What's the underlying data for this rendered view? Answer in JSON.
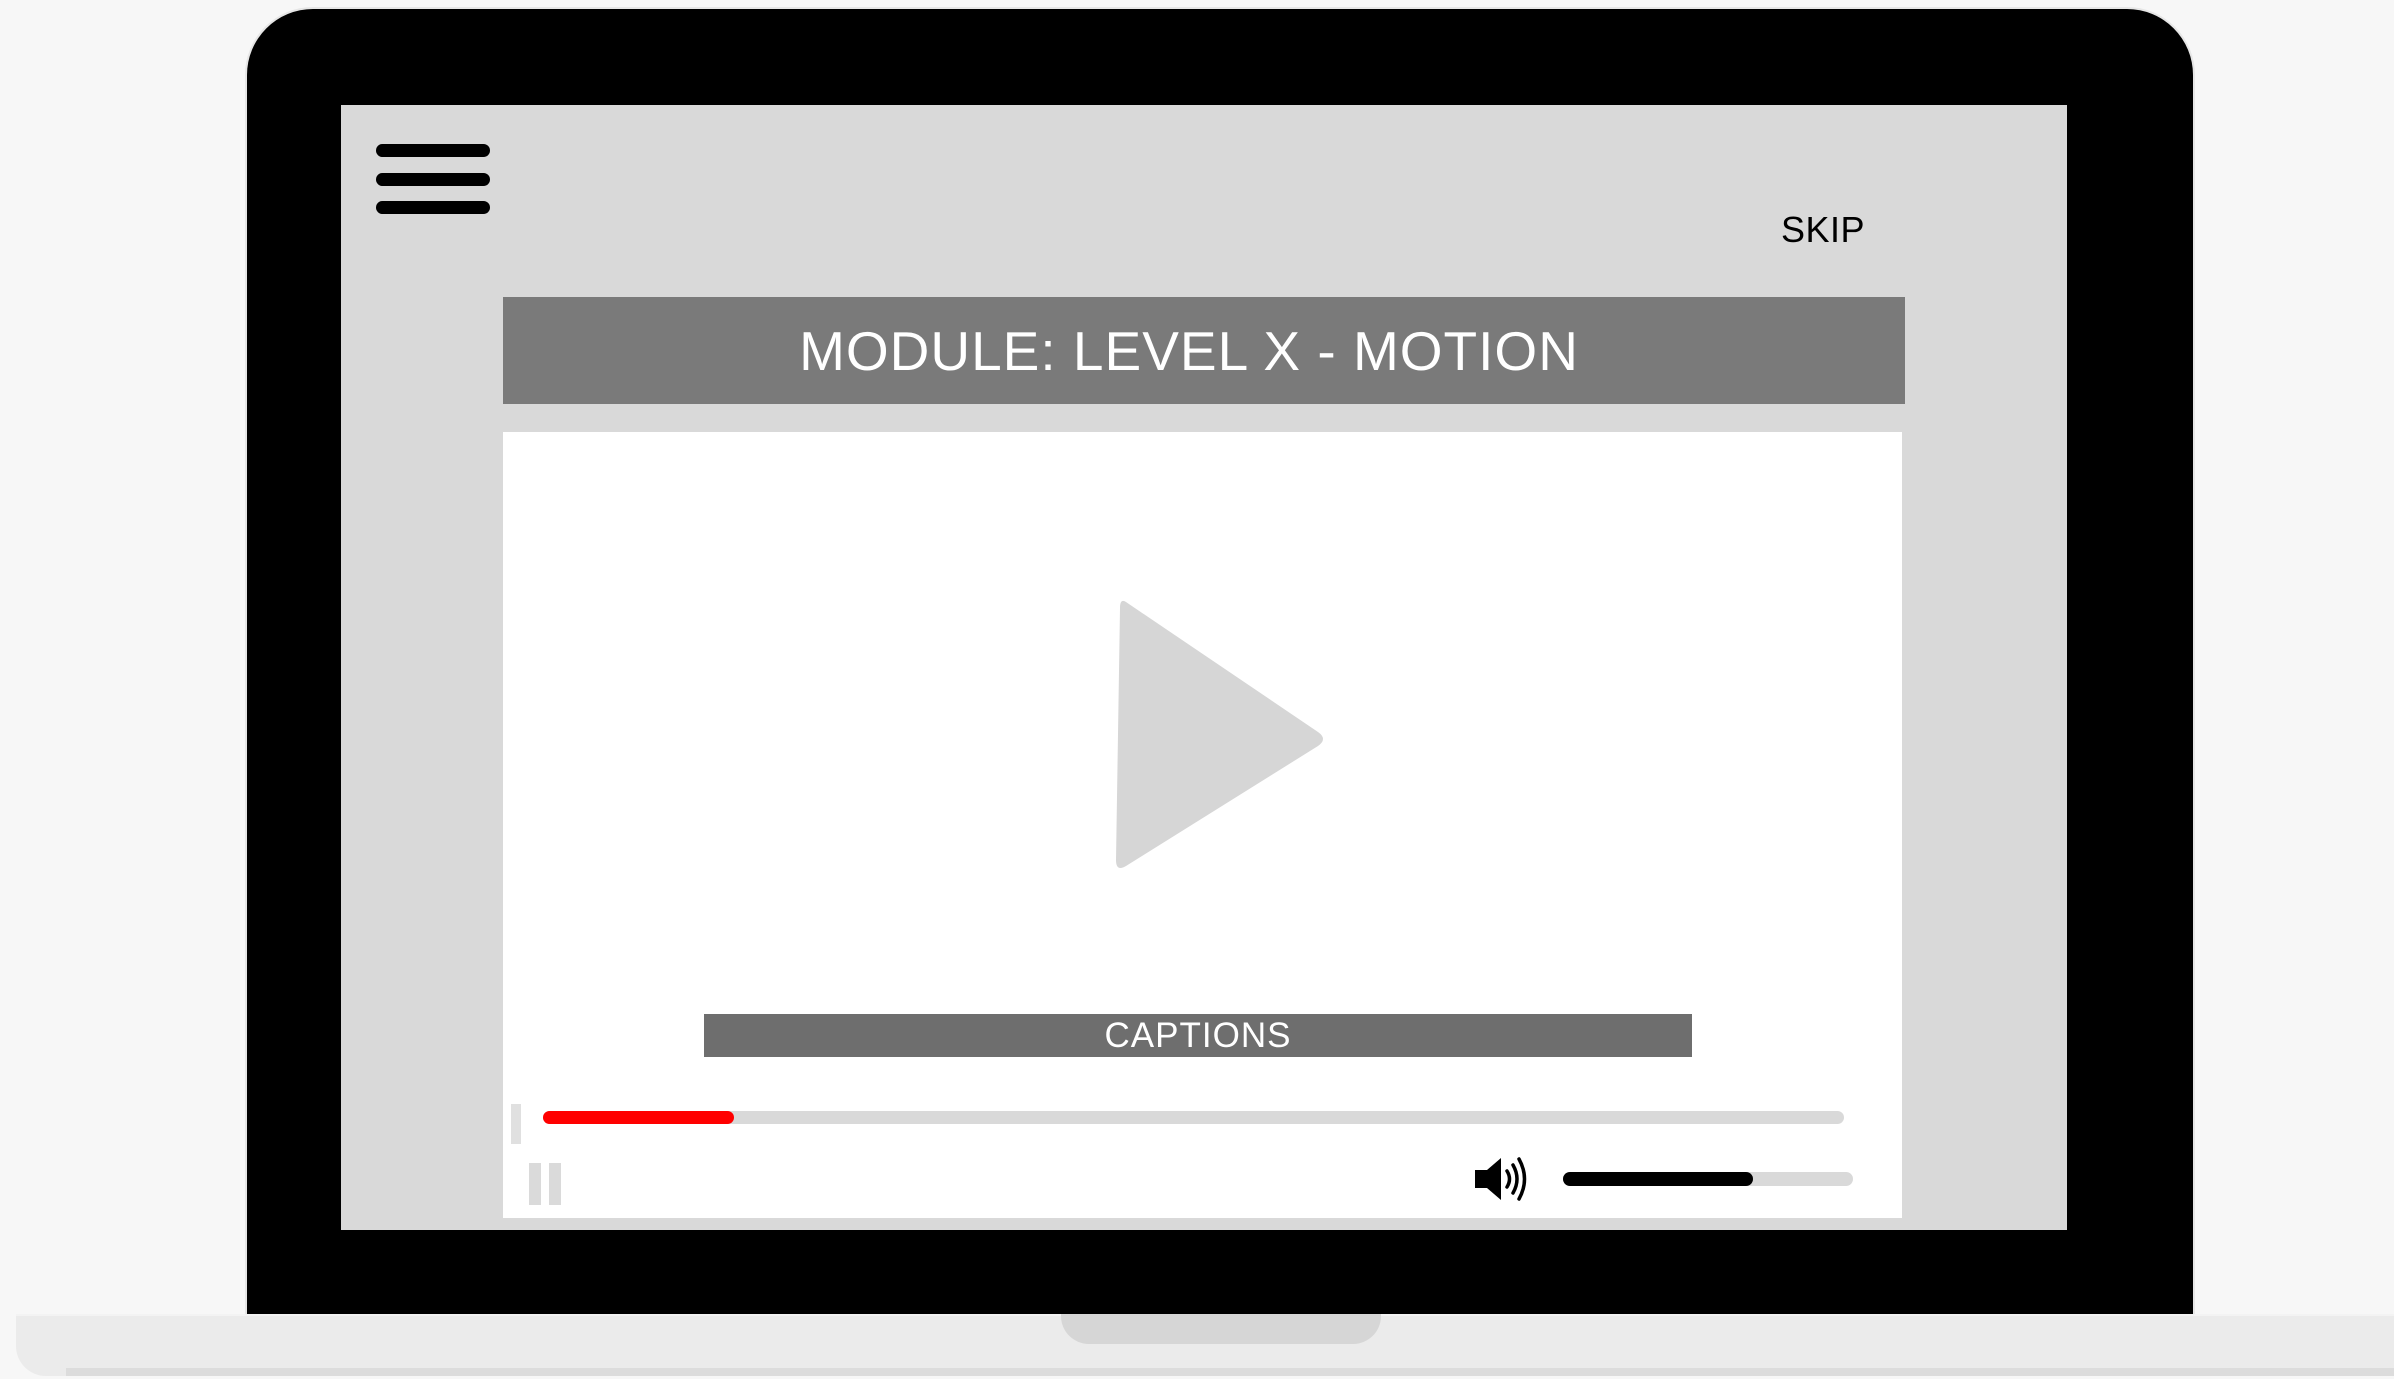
{
  "header": {
    "menu_icon": "hamburger-menu-icon",
    "skip_label": "SKIP"
  },
  "module": {
    "title": "MODULE: LEVEL X - MOTION"
  },
  "player": {
    "play_icon": "play-icon",
    "captions_label": "CAPTIONS",
    "pause_icon": "pause-icon",
    "volume_icon": "speaker-volume-icon",
    "progress_fraction": 0.147,
    "volume_fraction": 0.655
  },
  "colors": {
    "progress": "#ff0000",
    "volume": "#000000",
    "header_bar": "#7a7a7a",
    "captions_bar": "#6e6e6e",
    "screen_bg": "#d9d9d9"
  }
}
